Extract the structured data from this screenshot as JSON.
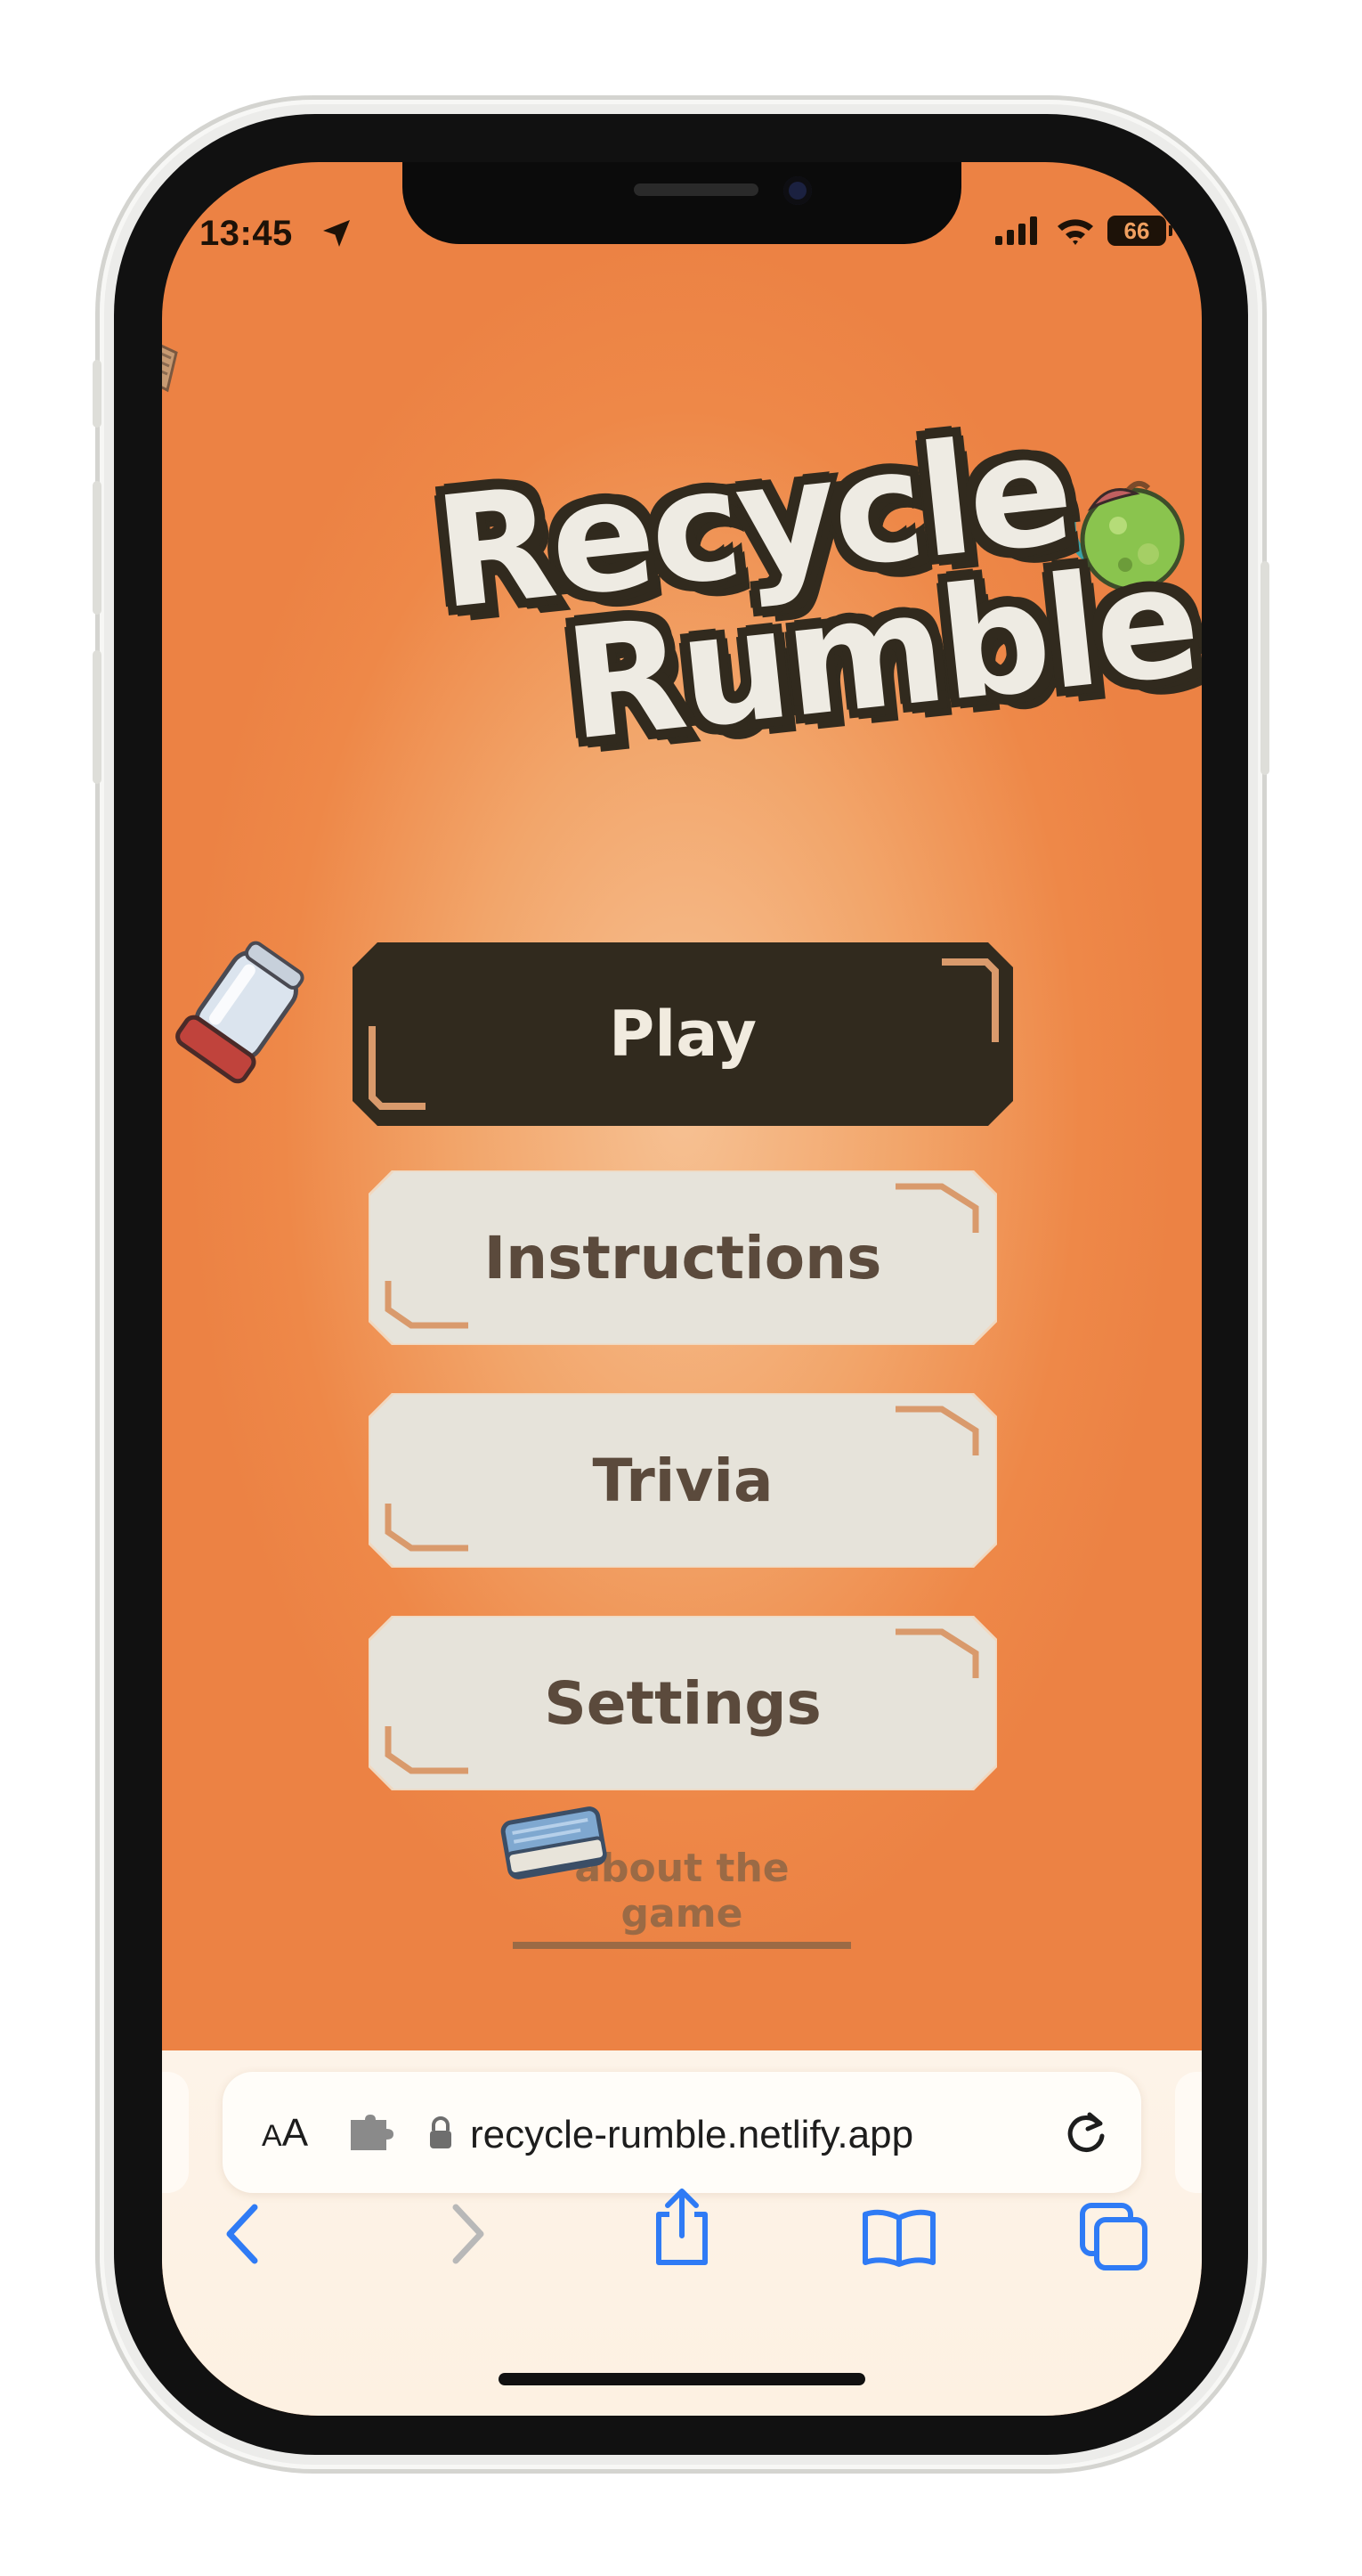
{
  "status_bar": {
    "time": "13:45",
    "battery": "66",
    "icons": [
      "location-arrow-icon",
      "signal-icon",
      "wifi-icon",
      "battery-icon"
    ]
  },
  "game": {
    "logo_line_1": "Recycle",
    "logo_line_2": "Rumble",
    "menu": {
      "play": "Play",
      "instructions": "Instructions",
      "trivia": "Trivia",
      "settings": "Settings"
    },
    "about_link": "about the game",
    "decorations": [
      "newspaper-icon",
      "glass-jar-icon",
      "rotten-apple-icon",
      "book-icon"
    ]
  },
  "browser": {
    "text_size_label_small": "A",
    "text_size_label_large": "A",
    "url": "recycle-rumble.netlify.app",
    "toolbar": [
      "back-icon",
      "forward-icon",
      "share-icon",
      "bookmarks-icon",
      "tabs-icon"
    ]
  },
  "colors": {
    "background_orange": "#ee8848",
    "background_center": "#f6c193",
    "dark_brown": "#312a1e",
    "cream": "#e6e3da",
    "accent_tan": "#d99a6c",
    "ios_blue": "#2f7bf5"
  }
}
